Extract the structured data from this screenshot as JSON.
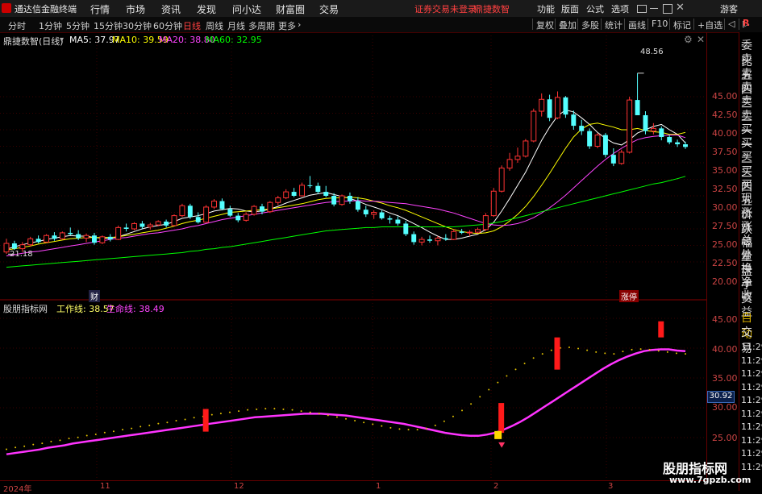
{
  "menubar": {
    "app_title": "通达信金融终端",
    "items": [
      "行情",
      "市场",
      "资讯",
      "发现",
      "问小达",
      "财富圈",
      "交易"
    ],
    "notice": "证券交易未登录",
    "stock_name": "鼎捷数智",
    "right_items": [
      "功能",
      "版面",
      "公式",
      "选项"
    ],
    "guest": "游客",
    "colors": {
      "notice": "#ff4040",
      "accent": "#ff3333"
    }
  },
  "toolbar": {
    "periods": [
      "分时",
      "1分钟",
      "5分钟",
      "15分钟",
      "30分钟",
      "60分钟",
      "日线",
      "周线",
      "月线",
      "多周期",
      "更多"
    ],
    "active_period": "日线",
    "right_buttons": [
      "复权",
      "叠加",
      "多股",
      "统计",
      "画线",
      "F10",
      "标记",
      "+自选",
      "◁",
      "▷"
    ]
  },
  "main_chart": {
    "title": "鼎捷数智(日线)",
    "ma_labels": [
      {
        "text": "MA5: 37.97",
        "color": "#ffffff"
      },
      {
        "text": "MA10: 39.59",
        "color": "#ffff00"
      },
      {
        "text": "MA20: 38.80",
        "color": "#ff44ff"
      },
      {
        "text": "MA60: 32.95",
        "color": "#00ff00"
      }
    ],
    "high_label": "48.56",
    "low_label": "21.18",
    "badge_cai": "财",
    "badge_zhangting": "涨停",
    "yaxis": [
      "45.00",
      "42.50",
      "40.00",
      "37.50",
      "35.00",
      "32.50",
      "30.00",
      "27.50",
      "25.00",
      "22.50",
      "20.00"
    ]
  },
  "indicator_chart": {
    "title": "股朋指标网",
    "work_label": "工作线: 38.57",
    "life_label": "生命线: 38.49",
    "yaxis": [
      "45.00",
      "40.00",
      "35.00",
      "30.00",
      "25.00"
    ],
    "current_value": "30.92"
  },
  "right_panel": {
    "items": [
      "委比",
      "卖五",
      "卖四",
      "卖三",
      "卖二",
      "卖一",
      "买一",
      "买二",
      "买三",
      "买四",
      "买五",
      "现价",
      "涨跌",
      "涨幅",
      "总量",
      "外盘",
      "换手",
      "净资",
      "收益"
    ],
    "lower_items": [
      "自动",
      "交易"
    ],
    "times": [
      "11:29",
      "11:29",
      "11:29",
      "11:29",
      "11:29",
      "11:29",
      "11:29",
      "11:29",
      "11:29",
      "11:29"
    ]
  },
  "xaxis": {
    "labels": [
      "2024年",
      "11",
      "12",
      "1",
      "2",
      "3"
    ]
  },
  "watermark": {
    "line1": "股朋指标网",
    "line2": "www.7gpzb.com"
  },
  "chart_data": [
    {
      "type": "candlestick",
      "title": "鼎捷数智(日线)",
      "ylim": [
        18.5,
        48.5
      ],
      "ohlc": [
        [
          21.5,
          23.5,
          21.2,
          22.8
        ],
        [
          22.8,
          23.2,
          21.8,
          22.0
        ],
        [
          22.0,
          23.0,
          21.5,
          22.6
        ],
        [
          22.6,
          23.8,
          22.3,
          23.5
        ],
        [
          23.5,
          24.0,
          22.8,
          23.0
        ],
        [
          23.0,
          24.2,
          22.9,
          24.0
        ],
        [
          24.0,
          24.5,
          23.2,
          23.5
        ],
        [
          23.5,
          24.6,
          23.4,
          24.4
        ],
        [
          24.4,
          25.2,
          24.0,
          24.2
        ],
        [
          24.2,
          24.8,
          23.3,
          23.6
        ],
        [
          23.6,
          24.3,
          23.0,
          24.0
        ],
        [
          24.0,
          24.4,
          22.6,
          22.9
        ],
        [
          22.9,
          24.0,
          22.7,
          23.8
        ],
        [
          23.8,
          24.2,
          23.1,
          23.4
        ],
        [
          23.4,
          25.5,
          23.3,
          25.2
        ],
        [
          25.2,
          25.8,
          24.6,
          25.0
        ],
        [
          25.0,
          26.0,
          24.8,
          25.8
        ],
        [
          25.8,
          26.2,
          25.0,
          25.3
        ],
        [
          25.3,
          25.9,
          24.9,
          25.6
        ],
        [
          25.6,
          26.3,
          25.4,
          26.1
        ],
        [
          26.1,
          26.4,
          25.2,
          25.5
        ],
        [
          25.5,
          27.2,
          25.4,
          27.0
        ],
        [
          27.0,
          28.8,
          26.8,
          28.5
        ],
        [
          28.5,
          28.8,
          26.5,
          26.8
        ],
        [
          26.8,
          27.5,
          25.8,
          26.0
        ],
        [
          26.0,
          28.6,
          25.9,
          28.3
        ],
        [
          28.3,
          29.5,
          28.0,
          29.2
        ],
        [
          29.2,
          29.6,
          27.8,
          28.0
        ],
        [
          28.0,
          28.5,
          26.8,
          27.0
        ],
        [
          27.0,
          27.4,
          26.0,
          26.3
        ],
        [
          26.3,
          27.5,
          26.1,
          27.2
        ],
        [
          27.2,
          28.6,
          27.0,
          28.4
        ],
        [
          28.4,
          28.8,
          27.2,
          27.6
        ],
        [
          27.6,
          29.2,
          27.4,
          29.0
        ],
        [
          29.0,
          30.0,
          28.6,
          29.7
        ],
        [
          29.7,
          31.0,
          29.5,
          30.6
        ],
        [
          30.6,
          31.2,
          29.8,
          30.0
        ],
        [
          30.0,
          32.0,
          29.9,
          31.6
        ],
        [
          31.6,
          33.0,
          31.2,
          31.5
        ],
        [
          31.5,
          32.0,
          30.3,
          30.6
        ],
        [
          30.6,
          31.5,
          29.8,
          30.0
        ],
        [
          30.0,
          30.4,
          28.4,
          28.7
        ],
        [
          28.7,
          30.2,
          28.5,
          30.0
        ],
        [
          30.0,
          30.5,
          28.8,
          29.2
        ],
        [
          29.2,
          29.8,
          27.6,
          27.9
        ],
        [
          27.9,
          28.5,
          26.8,
          27.2
        ],
        [
          27.2,
          27.8,
          26.5,
          27.5
        ],
        [
          27.5,
          27.8,
          26.4,
          26.6
        ],
        [
          26.6,
          27.0,
          25.8,
          26.4
        ],
        [
          26.4,
          26.9,
          25.5,
          25.8
        ],
        [
          25.8,
          26.2,
          23.9,
          24.2
        ],
        [
          24.2,
          24.6,
          22.6,
          23.0
        ],
        [
          23.0,
          23.8,
          22.5,
          23.4
        ],
        [
          23.4,
          24.0,
          22.9,
          23.2
        ],
        [
          23.2,
          23.9,
          22.5,
          23.6
        ],
        [
          23.6,
          24.2,
          23.2,
          23.4
        ],
        [
          23.4,
          25.0,
          23.3,
          24.6
        ],
        [
          24.6,
          25.0,
          24.2,
          24.4
        ],
        [
          24.4,
          24.8,
          23.9,
          24.5
        ],
        [
          24.5,
          25.2,
          24.3,
          24.9
        ],
        [
          24.9,
          27.4,
          24.7,
          27.0
        ],
        [
          27.0,
          31.2,
          26.8,
          30.7
        ],
        [
          30.7,
          34.6,
          30.5,
          34.2
        ],
        [
          34.2,
          36.5,
          33.8,
          35.5
        ],
        [
          35.5,
          37.3,
          35.0,
          36.0
        ],
        [
          36.0,
          38.6,
          35.8,
          38.3
        ],
        [
          38.3,
          43.2,
          38.1,
          42.8
        ],
        [
          42.8,
          45.5,
          42.0,
          44.6
        ],
        [
          44.6,
          45.3,
          41.3,
          41.8
        ],
        [
          41.8,
          45.8,
          41.6,
          44.9
        ],
        [
          44.9,
          45.1,
          41.8,
          42.3
        ],
        [
          42.3,
          42.9,
          40.0,
          40.6
        ],
        [
          40.6,
          41.5,
          39.2,
          39.8
        ],
        [
          39.8,
          40.2,
          37.1,
          37.5
        ],
        [
          37.5,
          39.5,
          37.2,
          39.2
        ],
        [
          39.2,
          39.5,
          35.8,
          36.2
        ],
        [
          36.2,
          37.2,
          34.5,
          34.9
        ],
        [
          34.9,
          37.0,
          34.7,
          36.6
        ],
        [
          36.6,
          45.0,
          36.4,
          44.5
        ],
        [
          44.5,
          48.56,
          44.0,
          42.2
        ],
        [
          42.2,
          42.8,
          39.3,
          39.8
        ],
        [
          39.8,
          41.0,
          39.3,
          40.2
        ],
        [
          40.2,
          40.5,
          38.4,
          38.9
        ],
        [
          38.9,
          39.2,
          37.8,
          38.1
        ],
        [
          38.1,
          38.5,
          37.4,
          37.8
        ],
        [
          37.8,
          38.2,
          37.1,
          37.4
        ]
      ],
      "series": [
        {
          "name": "MA5",
          "values": [
            21.9,
            22.3,
            22.6,
            22.9,
            23.1,
            23.4,
            23.6,
            23.8,
            24.0,
            23.9,
            23.9,
            23.7,
            23.6,
            23.6,
            23.8,
            24.2,
            24.6,
            25.0,
            25.3,
            25.5,
            25.7,
            26.1,
            26.6,
            26.8,
            27.0,
            27.3,
            27.7,
            27.9,
            28.1,
            28.0,
            27.7,
            27.6,
            27.7,
            28.0,
            28.4,
            28.9,
            29.3,
            29.7,
            30.1,
            30.3,
            30.5,
            30.2,
            29.9,
            29.6,
            29.2,
            28.7,
            28.3,
            27.9,
            27.4,
            27.0,
            26.4,
            25.8,
            25.2,
            24.5,
            23.9,
            23.4,
            23.4,
            23.6,
            23.9,
            24.2,
            24.9,
            26.0,
            27.7,
            29.6,
            31.6,
            33.6,
            36.0,
            38.4,
            40.4,
            42.1,
            43.0,
            42.7,
            41.8,
            40.8,
            39.6,
            38.7,
            38.0,
            37.7,
            38.5,
            39.5,
            40.0,
            40.5,
            40.8,
            40.0,
            39.3,
            38.0
          ]
        },
        {
          "name": "MA10",
          "values": [
            21.8,
            22.0,
            22.2,
            22.4,
            22.7,
            22.9,
            23.1,
            23.3,
            23.5,
            23.6,
            23.7,
            23.7,
            23.7,
            23.7,
            23.8,
            24.0,
            24.2,
            24.4,
            24.6,
            24.8,
            25.1,
            25.4,
            25.8,
            26.1,
            26.3,
            26.6,
            26.9,
            27.2,
            27.5,
            27.6,
            27.7,
            27.8,
            27.9,
            28.0,
            28.2,
            28.4,
            28.6,
            28.8,
            29.1,
            29.4,
            29.6,
            29.7,
            29.7,
            29.8,
            29.7,
            29.5,
            29.2,
            28.9,
            28.5,
            28.2,
            27.8,
            27.3,
            26.8,
            26.3,
            25.8,
            25.3,
            24.9,
            24.6,
            24.4,
            24.3,
            24.4,
            24.7,
            25.3,
            26.2,
            27.2,
            28.4,
            29.9,
            31.6,
            33.4,
            35.3,
            37.2,
            38.9,
            40.1,
            40.8,
            41.0,
            40.7,
            40.4,
            40.0,
            40.0,
            40.2,
            39.9,
            39.7,
            39.6,
            39.3,
            39.3,
            39.6
          ]
        },
        {
          "name": "MA20",
          "values": [
            20.9,
            21.1,
            21.3,
            21.5,
            21.6,
            21.8,
            22.0,
            22.2,
            22.4,
            22.6,
            22.8,
            23.0,
            23.2,
            23.4,
            23.6,
            23.7,
            23.9,
            24.1,
            24.3,
            24.4,
            24.6,
            24.8,
            25.0,
            25.3,
            25.5,
            25.8,
            26.1,
            26.4,
            26.6,
            26.8,
            27.0,
            27.2,
            27.4,
            27.6,
            27.8,
            28.0,
            28.2,
            28.4,
            28.6,
            28.8,
            29.0,
            29.1,
            29.2,
            29.2,
            29.3,
            29.2,
            29.2,
            29.1,
            29.0,
            28.9,
            28.8,
            28.6,
            28.4,
            28.2,
            28.0,
            27.7,
            27.4,
            27.0,
            26.6,
            26.2,
            25.8,
            25.6,
            25.5,
            25.6,
            25.8,
            26.2,
            26.7,
            27.4,
            28.2,
            29.1,
            30.1,
            31.2,
            32.3,
            33.4,
            34.5,
            35.5,
            36.4,
            37.2,
            37.9,
            38.5,
            38.8,
            39.0,
            39.1,
            39.2,
            39.2,
            38.8
          ]
        },
        {
          "name": "MA60",
          "values": [
            19.2,
            19.3,
            19.4,
            19.5,
            19.6,
            19.7,
            19.8,
            19.9,
            20.0,
            20.1,
            20.2,
            20.3,
            20.4,
            20.5,
            20.6,
            20.7,
            20.8,
            20.9,
            21.0,
            21.1,
            21.2,
            21.3,
            21.4,
            21.6,
            21.7,
            21.9,
            22.0,
            22.2,
            22.3,
            22.5,
            22.7,
            22.9,
            23.1,
            23.3,
            23.5,
            23.7,
            23.9,
            24.1,
            24.3,
            24.5,
            24.7,
            24.8,
            24.9,
            25.0,
            25.1,
            25.2,
            25.2,
            25.3,
            25.3,
            25.3,
            25.3,
            25.3,
            25.3,
            25.3,
            25.3,
            25.3,
            25.3,
            25.4,
            25.5,
            25.6,
            25.7,
            25.9,
            26.1,
            26.4,
            26.7,
            27.0,
            27.3,
            27.6,
            27.9,
            28.2,
            28.5,
            28.8,
            29.1,
            29.4,
            29.7,
            30.0,
            30.3,
            30.6,
            30.9,
            31.2,
            31.5,
            31.8,
            32.0,
            32.3,
            32.6,
            32.95
          ]
        }
      ]
    },
    {
      "type": "line",
      "title": "股朋指标网",
      "ylim": [
        21.5,
        47.5
      ],
      "series": [
        {
          "name": "工作线",
          "values": [
            22.2,
            22.4,
            22.6,
            22.8,
            23.0,
            23.3,
            23.5,
            23.7,
            24.0,
            24.2,
            24.4,
            24.6,
            24.8,
            25.0,
            25.2,
            25.4,
            25.6,
            25.8,
            26.0,
            26.2,
            26.4,
            26.6,
            26.8,
            27.0,
            27.2,
            27.4,
            27.6,
            27.8,
            28.0,
            28.2,
            28.4,
            28.5,
            28.6,
            28.7,
            28.8,
            28.9,
            29.0,
            29.0,
            29.0,
            28.9,
            28.8,
            28.7,
            28.5,
            28.3,
            28.1,
            27.9,
            27.7,
            27.5,
            27.3,
            27.0,
            26.7,
            26.4,
            26.1,
            25.8,
            25.6,
            25.4,
            25.3,
            25.3,
            25.5,
            25.8,
            26.3,
            26.9,
            27.6,
            28.4,
            29.3,
            30.2,
            31.1,
            32.0,
            32.9,
            33.8,
            34.7,
            35.6,
            36.5,
            37.3,
            38.0,
            38.6,
            39.1,
            39.5,
            39.7,
            39.8,
            39.8,
            39.6,
            39.5
          ]
        },
        {
          "name": "生命线",
          "values": [
            22.5,
            22.8,
            23.0,
            23.3,
            23.5,
            23.8,
            24.0,
            24.3,
            24.5,
            24.8,
            25.0,
            25.3,
            25.5,
            25.8,
            26.0,
            26.3,
            26.5,
            26.8,
            27.0,
            27.3,
            27.5,
            27.8,
            28.0,
            28.3,
            28.5,
            28.7,
            28.9,
            29.1,
            29.2,
            29.3,
            29.3,
            29.2,
            29.1,
            28.9,
            28.7,
            28.5,
            28.2,
            27.9,
            27.6,
            27.3,
            27.0,
            26.7,
            26.4,
            26.1,
            25.9,
            25.8,
            25.8,
            26.0,
            26.5,
            27.2,
            28.0,
            29.0,
            30.1,
            31.3,
            32.5,
            33.7,
            34.8,
            35.9,
            36.9,
            37.8,
            38.5,
            39.1,
            39.5,
            39.6,
            39.4,
            39.1,
            38.8,
            38.6,
            38.5,
            38.9,
            39.2,
            39.3,
            39.2,
            39.0,
            38.8,
            38.6,
            38.49
          ]
        }
      ],
      "bars": [
        {
          "index": 25,
          "low": 26.0,
          "high": 29.8
        },
        {
          "index": 62,
          "low": 25.8,
          "high": 30.8
        },
        {
          "index": 69,
          "low": 36.4,
          "high": 41.8
        },
        {
          "index": 82,
          "low": 41.8,
          "high": 44.5
        }
      ]
    }
  ]
}
